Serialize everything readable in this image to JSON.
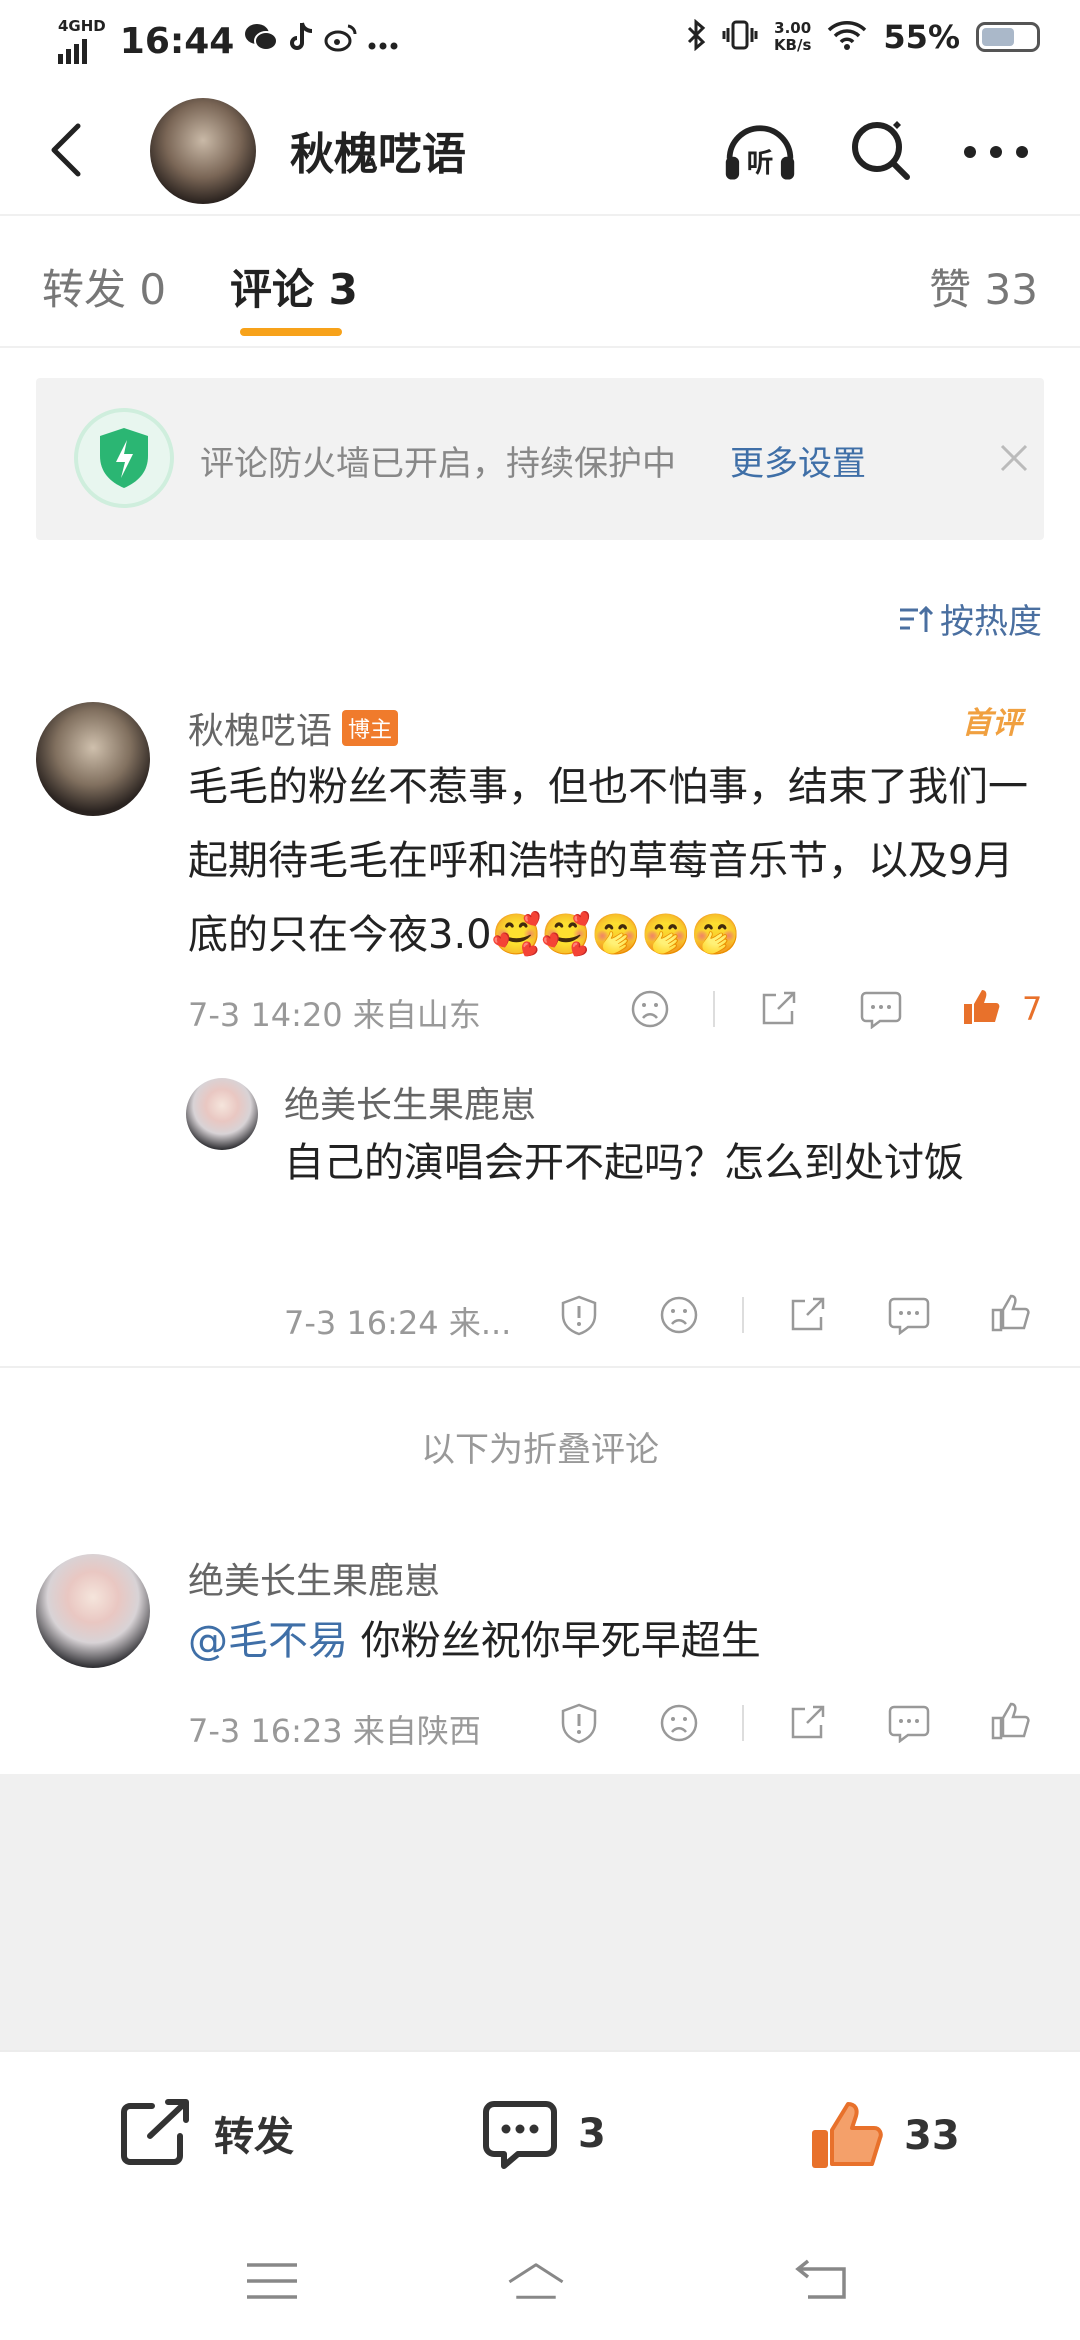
{
  "status_bar": {
    "network": "4GHD",
    "time": "16:44",
    "speed_value": "3.00",
    "speed_unit": "KB/s",
    "battery": "55%"
  },
  "header": {
    "title": "秋槐呓语"
  },
  "tabs": [
    {
      "label": "转发",
      "count": "0"
    },
    {
      "label": "评论",
      "count": "3"
    },
    {
      "label": "赞",
      "count": "33"
    }
  ],
  "notice": {
    "text": "评论防火墙已开启，持续保护中",
    "link": "更多设置"
  },
  "sort_label": "按热度",
  "comments": [
    {
      "user": "秋槐呓语",
      "badge": "博主",
      "first_badge": "首评",
      "text": "毛毛的粉丝不惹事，但也不怕事，结束了我们一起期待毛毛在呼和浩特的草莓音乐节，以及9月底的只在今夜3.0🥰🥰🤭🤭🤭",
      "meta": "7-3 14:20  来自山东",
      "likes": "7",
      "reply": {
        "user": "绝美长生果鹿崽",
        "text": "自己的演唱会开不起吗？怎么到处讨饭",
        "meta": "7-3 16:24  来..."
      }
    },
    {
      "user": "绝美长生果鹿崽",
      "mention": "@毛不易",
      "text": " 你粉丝祝你早死早超生",
      "meta": "7-3 16:23  来自陕西"
    }
  ],
  "folded_label": "以下为折叠评论",
  "bottom_bar": {
    "repost_label": "转发",
    "comment_count": "3",
    "like_count": "33"
  },
  "colors": {
    "accent_orange": "#f7a21a",
    "link_blue": "#3f6fa7",
    "like_orange": "#e8712b",
    "badge_orange": "#f07b2c"
  }
}
